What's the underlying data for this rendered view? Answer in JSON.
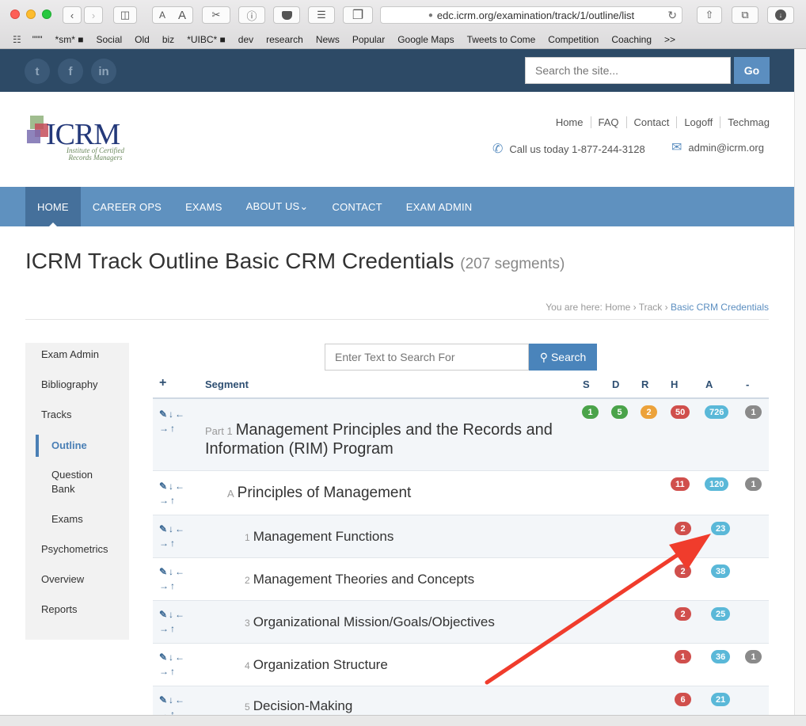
{
  "browser": {
    "url": "edc.icrm.org/examination/track/1/outline/list",
    "bookmarks": [
      "\"\"\"",
      "*sm* ■",
      "Social",
      "Old",
      "biz",
      "*UIBC* ■",
      "dev",
      "research",
      "News",
      "Popular",
      "Google Maps",
      "Tweets to Come",
      "Competition",
      "Coaching",
      ">>"
    ],
    "font_small": "A",
    "font_large": "A"
  },
  "site": {
    "search_placeholder": "Search the site...",
    "go_label": "Go",
    "social": [
      "t",
      "f",
      "in"
    ],
    "logo_text": "ICRM",
    "logo_tagline_1": "Institute of Certified",
    "logo_tagline_2": "Records Managers",
    "header_links": [
      "Home",
      "FAQ",
      "Contact",
      "Logoff",
      "Techmag"
    ],
    "phone": "Call us today 1-877-244-3128",
    "email": "admin@icrm.org"
  },
  "nav": {
    "items": [
      "HOME",
      "CAREER OPS",
      "EXAMS",
      "ABOUT US⌄",
      "CONTACT",
      "EXAM ADMIN"
    ],
    "active": "HOME"
  },
  "page": {
    "title": "ICRM Track Outline Basic CRM Credentials",
    "segment_count": "(207 segments)",
    "breadcrumb_prefix": "You are here:",
    "breadcrumb": [
      "Home",
      "Track",
      "Basic CRM Credentials"
    ]
  },
  "sidebar": {
    "items": [
      "Exam Admin",
      "Bibliography",
      "Tracks",
      "Outline",
      "Question",
      "Bank",
      "Exams",
      "Psychometrics",
      "Overview",
      "Reports"
    ],
    "active": "Outline"
  },
  "outline": {
    "search_placeholder": "Enter Text to Search For",
    "search_label": "Search",
    "columns": [
      "+",
      "Segment",
      "S",
      "D",
      "R",
      "H",
      "A",
      "-"
    ],
    "rows": [
      {
        "num": "Part 1",
        "title_line1": "Management Principles and the Records and",
        "title_line2": "Information (RIM) Program",
        "S": "1",
        "D": "5",
        "R": "2",
        "H": "50",
        "A": "726",
        "X": "1"
      },
      {
        "num": "A",
        "title": "Principles of Management",
        "H": "11",
        "A": "120",
        "X": "1"
      },
      {
        "num": "1",
        "title": "Management Functions",
        "H": "2",
        "A": "23"
      },
      {
        "num": "2",
        "title": "Management Theories and Concepts",
        "H": "2",
        "A": "38"
      },
      {
        "num": "3",
        "title": "Organizational Mission/Goals/Objectives",
        "H": "2",
        "A": "25"
      },
      {
        "num": "4",
        "title": "Organization Structure",
        "H": "1",
        "A": "36",
        "X": "1"
      },
      {
        "num": "5",
        "title": "Decision-Making",
        "H": "6",
        "A": "21"
      }
    ],
    "row_tools_line1": "✎↓←",
    "row_tools_line2": "→↑"
  },
  "colors": {
    "topbar": "#2d4a66",
    "nav": "#5f91bf",
    "nav_active": "#45709b",
    "badge_green": "#4aa34a",
    "badge_orange": "#eca23b",
    "badge_red": "#d04f4c",
    "badge_blue": "#5ab8d8",
    "badge_gray": "#8a8a8a",
    "annotation_arrow": "#f03c2c"
  }
}
